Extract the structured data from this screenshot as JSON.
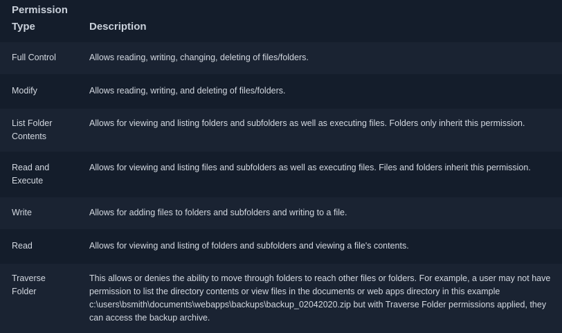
{
  "table": {
    "headers": {
      "type": "Permission Type",
      "description": "Description"
    },
    "rows": [
      {
        "type": "Full Control",
        "description": "Allows reading, writing, changing, deleting of files/folders."
      },
      {
        "type": "Modify",
        "description": "Allows reading, writing, and deleting of files/folders."
      },
      {
        "type": "List Folder Contents",
        "description": "Allows for viewing and listing folders and subfolders as well as executing files. Folders only inherit this permission."
      },
      {
        "type": "Read and Execute",
        "description": "Allows for viewing and listing files and subfolders as well as executing files. Files and folders inherit this permission."
      },
      {
        "type": "Write",
        "description": "Allows for adding files to folders and subfolders and writing to a file."
      },
      {
        "type": "Read",
        "description": "Allows for viewing and listing of folders and subfolders and viewing a file's contents."
      },
      {
        "type": "Traverse Folder",
        "description": "This allows or denies the ability to move through folders to reach other files or folders. For example, a user may not have permission to list the directory contents or view files in the documents or web apps directory in this example c:\\users\\bsmith\\documents\\webapps\\backups\\backup_02042020.zip but with Traverse Folder permissions applied, they can access the backup archive."
      }
    ]
  },
  "colors": {
    "background": "#141d2b",
    "row_alt": "#1a2332",
    "text": "#d3d8e0"
  }
}
